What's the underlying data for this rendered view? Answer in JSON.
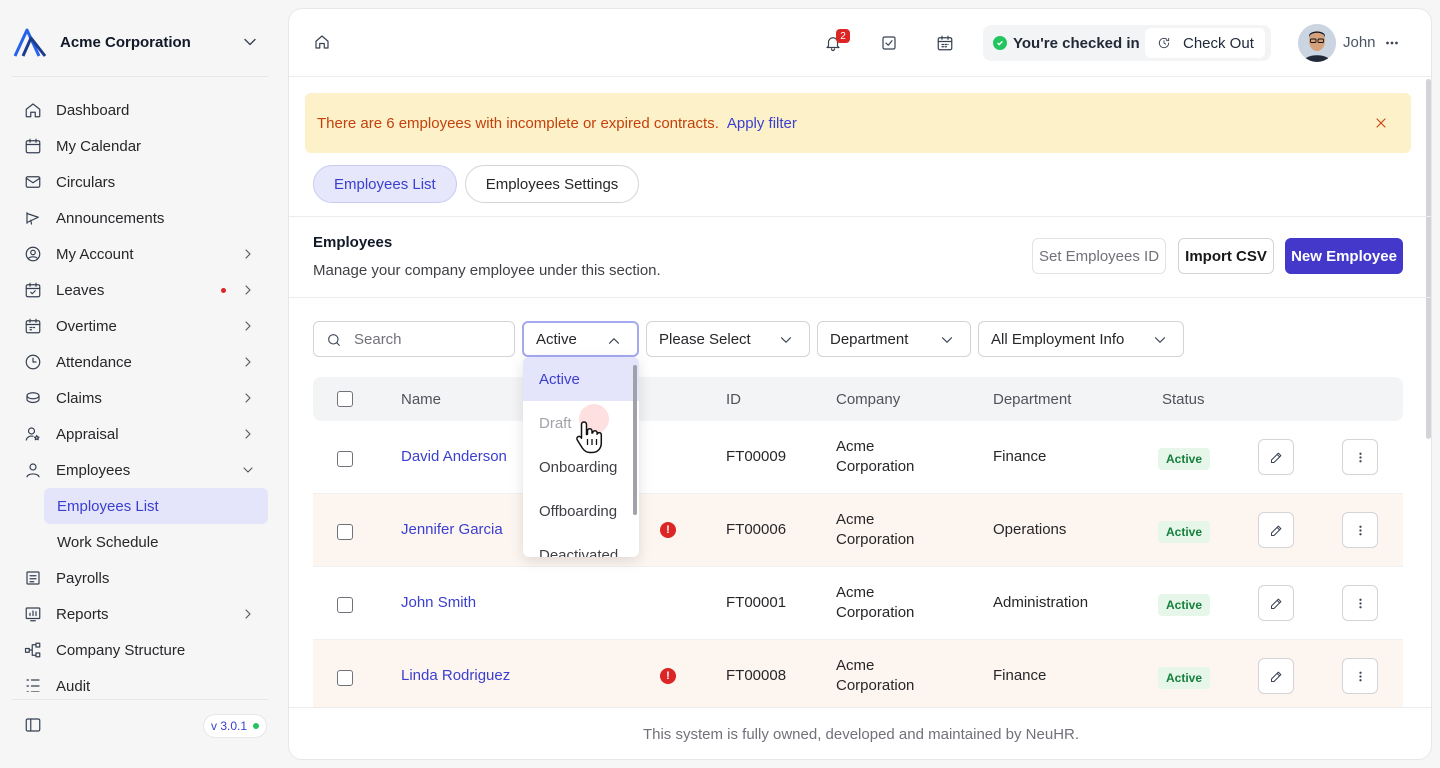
{
  "sidebar": {
    "company": "Acme Corporation",
    "items": [
      {
        "label": "Dashboard",
        "icon": "home-icon"
      },
      {
        "label": "My Calendar",
        "icon": "calendar-icon"
      },
      {
        "label": "Circulars",
        "icon": "mail-icon"
      },
      {
        "label": "Announcements",
        "icon": "megaphone-icon"
      },
      {
        "label": "My Account",
        "icon": "user-circle-icon"
      },
      {
        "label": "Leaves",
        "icon": "calendar-check-icon"
      },
      {
        "label": "Overtime",
        "icon": "calendar-clock-icon"
      },
      {
        "label": "Attendance",
        "icon": "clock-icon"
      },
      {
        "label": "Claims",
        "icon": "coins-icon"
      },
      {
        "label": "Appraisal",
        "icon": "user-star-icon"
      },
      {
        "label": "Employees",
        "icon": "user-icon"
      },
      {
        "label": "Payrolls",
        "icon": "receipt-icon"
      },
      {
        "label": "Reports",
        "icon": "report-icon"
      },
      {
        "label": "Company Structure",
        "icon": "sitemap-icon"
      },
      {
        "label": "Audit",
        "icon": "audit-icon"
      }
    ],
    "employees_sub": [
      "Employees List",
      "Work Schedule"
    ],
    "version": "v 3.0.1"
  },
  "topbar": {
    "notification_count": "2",
    "checked_in_text": "You're checked in",
    "check_out_label": "Check Out",
    "user_name": "John"
  },
  "alert": {
    "message": "There are 6 employees with incomplete or expired contracts.",
    "link": "Apply filter"
  },
  "tabs": [
    "Employees List",
    "Employees Settings"
  ],
  "section": {
    "title": "Employees",
    "subtitle": "Manage your company employee under this section.",
    "set_id_label": "Set Employees ID",
    "import_label": "Import CSV",
    "new_label": "New Employee"
  },
  "filters": {
    "search_placeholder": "Search",
    "status_value": "Active",
    "please_select": "Please Select",
    "department": "Department",
    "employment_info": "All Employment Info"
  },
  "status_options": [
    "Active",
    "Draft",
    "Onboarding",
    "Offboarding",
    "Deactivated"
  ],
  "table": {
    "columns": [
      "Name",
      "ID",
      "Company",
      "Department",
      "Status"
    ],
    "rows": [
      {
        "name": "David Anderson",
        "id": "FT00009",
        "company_line1": "Acme",
        "company_line2": "Corporation",
        "department": "Finance",
        "status": "Active",
        "warning": false
      },
      {
        "name": "Jennifer Garcia",
        "id": "FT00006",
        "company_line1": "Acme",
        "company_line2": "Corporation",
        "department": "Operations",
        "status": "Active",
        "warning": true
      },
      {
        "name": "John Smith",
        "id": "FT00001",
        "company_line1": "Acme",
        "company_line2": "Corporation",
        "department": "Administration",
        "status": "Active",
        "warning": false
      },
      {
        "name": "Linda Rodriguez",
        "id": "FT00008",
        "company_line1": "Acme",
        "company_line2": "Corporation",
        "department": "Finance",
        "status": "Active",
        "warning": true
      }
    ]
  },
  "footer": "This system is fully owned, developed and maintained by NeuHR.",
  "colors": {
    "accent": "#4338ca",
    "alert_bg": "#fdf1c9",
    "alert_text": "#c2410c",
    "status_green": "#15803d"
  }
}
